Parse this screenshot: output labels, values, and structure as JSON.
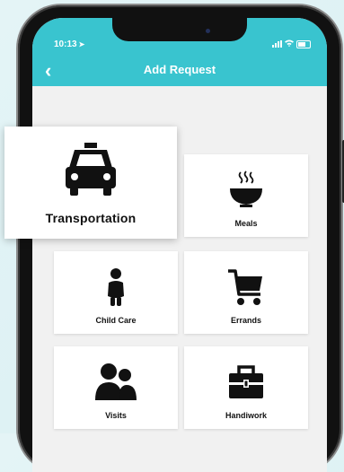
{
  "status_bar": {
    "time": "10:13"
  },
  "nav": {
    "title": "Add Request",
    "back_icon": "chevron-left-icon"
  },
  "colors": {
    "accent": "#39c4cf",
    "tile_bg": "#ffffff",
    "screen_bg": "#f1f1f1"
  },
  "tiles": [
    {
      "label": "Transportation",
      "icon": "taxi-icon"
    },
    {
      "label": "Meals",
      "icon": "bowl-icon"
    },
    {
      "label": "Child Care",
      "icon": "child-icon"
    },
    {
      "label": "Errands",
      "icon": "cart-icon"
    },
    {
      "label": "Visits",
      "icon": "people-icon"
    },
    {
      "label": "Handiwork",
      "icon": "toolbox-icon"
    }
  ]
}
